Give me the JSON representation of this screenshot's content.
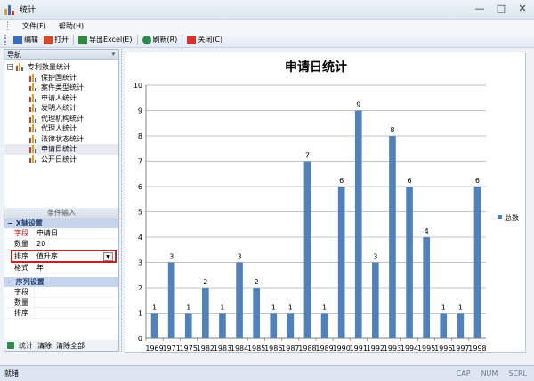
{
  "window": {
    "title": "统计",
    "minimize": "—",
    "maximize": "□",
    "close": "✕"
  },
  "menu": [
    "文件(F)",
    "帮助(H)"
  ],
  "toolbar": [
    {
      "label": "编辑",
      "icon": "edit-icon",
      "color": "#3a6bc4"
    },
    {
      "label": "打开",
      "icon": "open-icon",
      "color": "#d24a2a"
    },
    {
      "label": "导出Excel(E)",
      "icon": "excel-icon",
      "color": "#2f8a3d"
    },
    {
      "label": "刷新(R)",
      "icon": "refresh-icon",
      "color": "#2b8a4a"
    },
    {
      "label": "关闭(C)",
      "icon": "close-icon",
      "color": "#d3322a"
    }
  ],
  "nav": {
    "title": "导航",
    "pin": "ᵠ",
    "root": {
      "label": "专利数量统计",
      "expander": "−"
    },
    "items": [
      "保护国统计",
      "案件类型统计",
      "申请人统计",
      "发明人统计",
      "代理机构统计",
      "代理人统计",
      "法律状态统计",
      "申请日统计",
      "公开日统计"
    ],
    "selected_index": 7
  },
  "conditions": {
    "header": "条件输入",
    "x_axis": {
      "title": "X轴设置",
      "toggle": "−",
      "field_label": "字段",
      "field_value": "申请日",
      "count_label": "数量",
      "count_value": "20",
      "sort_label": "排序",
      "sort_value": "值升序",
      "sort_arrow": "▼",
      "format_label": "格式",
      "format_value": "年"
    },
    "series": {
      "title": "序列设置",
      "toggle": "−",
      "field_label": "字段",
      "count_label": "数量",
      "sort_label": "排序"
    }
  },
  "actions": {
    "stats": "统计",
    "clear": "清除",
    "clear_all": "清除全部"
  },
  "status": {
    "left": "就绪",
    "caps": "CAP",
    "num": "NUM",
    "scrl": "SCRL"
  },
  "colors": {
    "bar": "#4f81bd",
    "selection_border": "#d11a1a"
  },
  "chart_data": {
    "type": "bar",
    "title": "申请日统计",
    "categories": [
      "1969",
      "1971",
      "1975",
      "1982",
      "1983",
      "1984",
      "1985",
      "1986",
      "1987",
      "1988",
      "1989",
      "1990",
      "1991",
      "1992",
      "1993",
      "1994",
      "1995",
      "1996",
      "1997",
      "1998"
    ],
    "series": [
      {
        "name": "总数",
        "values": [
          1,
          3,
          1,
          2,
          1,
          3,
          2,
          1,
          1,
          7,
          1,
          6,
          9,
          3,
          8,
          6,
          4,
          1,
          1,
          6
        ]
      }
    ],
    "ylim": [
      0,
      10
    ],
    "yticks": [
      0,
      1,
      2,
      3,
      4,
      5,
      6,
      7,
      8,
      9,
      10
    ],
    "legend": "right",
    "grid": true
  }
}
